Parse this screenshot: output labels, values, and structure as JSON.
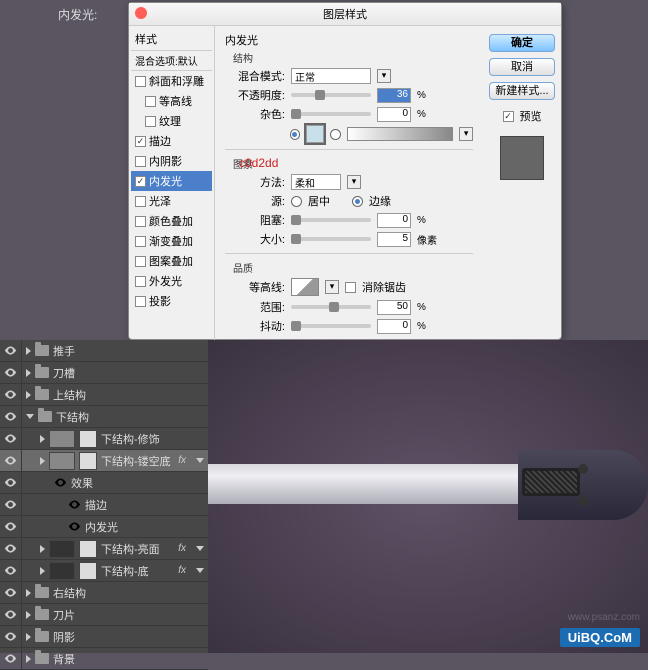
{
  "topLabel": "内发光:",
  "dialog": {
    "title": "图层样式",
    "styleHeader": "样式",
    "blendDefault": "混合选项:默认",
    "styles": [
      {
        "label": "斜面和浮雕",
        "checked": false
      },
      {
        "label": "等高线",
        "checked": false,
        "indent": true
      },
      {
        "label": "纹理",
        "checked": false,
        "indent": true
      },
      {
        "label": "描边",
        "checked": true
      },
      {
        "label": "内阴影",
        "checked": false
      },
      {
        "label": "内发光",
        "checked": true,
        "selected": true
      },
      {
        "label": "光泽",
        "checked": false
      },
      {
        "label": "颜色叠加",
        "checked": false
      },
      {
        "label": "渐变叠加",
        "checked": false
      },
      {
        "label": "图案叠加",
        "checked": false
      },
      {
        "label": "外发光",
        "checked": false
      },
      {
        "label": "投影",
        "checked": false
      }
    ],
    "panel": {
      "title": "内发光",
      "structure": "结构",
      "blendMode": "混合模式:",
      "blendValue": "正常",
      "opacity": "不透明度:",
      "opacityVal": "36",
      "noise": "杂色:",
      "noiseVal": "0",
      "pct": "%",
      "colorCode": "c0d2dd",
      "elements": "图素",
      "method": "方法:",
      "methodVal": "柔和",
      "source": "源:",
      "sourceCenter": "居中",
      "sourceEdge": "边缘",
      "choke": "阻塞:",
      "chokeVal": "0",
      "size": "大小:",
      "sizeVal": "5",
      "px": "像素",
      "quality": "品质",
      "contour": "等高线:",
      "antialias": "消除锯齿",
      "range": "范围:",
      "rangeVal": "50",
      "jitter": "抖动:",
      "jitterVal": "0"
    },
    "buttons": {
      "ok": "确定",
      "cancel": "取消",
      "newStyle": "新建样式...",
      "preview": "预览"
    }
  },
  "layers": [
    {
      "type": "folder",
      "label": "推手",
      "open": false
    },
    {
      "type": "folder",
      "label": "刀槽",
      "open": false
    },
    {
      "type": "folder",
      "label": "上结构",
      "open": false
    },
    {
      "type": "folder",
      "label": "下结构",
      "open": true
    },
    {
      "type": "layer",
      "label": "下结构-修饰",
      "indent": 1
    },
    {
      "type": "layer",
      "label": "下结构-镂空底",
      "indent": 1,
      "fx": true,
      "selected": true
    },
    {
      "type": "fx",
      "label": "效果",
      "indent": 2
    },
    {
      "type": "fx",
      "label": "描边",
      "indent": 3
    },
    {
      "type": "fx",
      "label": "内发光",
      "indent": 3
    },
    {
      "type": "layer",
      "label": "下结构-亮面",
      "indent": 1,
      "fx": true,
      "dark": true
    },
    {
      "type": "layer",
      "label": "下结构-底",
      "indent": 1,
      "fx": true,
      "dark": true
    },
    {
      "type": "folder",
      "label": "右结构",
      "open": false
    },
    {
      "type": "folder",
      "label": "刀片",
      "open": false
    },
    {
      "type": "folder",
      "label": "阴影",
      "open": false
    },
    {
      "type": "folder",
      "label": "背景",
      "open": false
    }
  ],
  "watermark": "UiBQ.CoM",
  "watermark2": "www.psanz.com"
}
